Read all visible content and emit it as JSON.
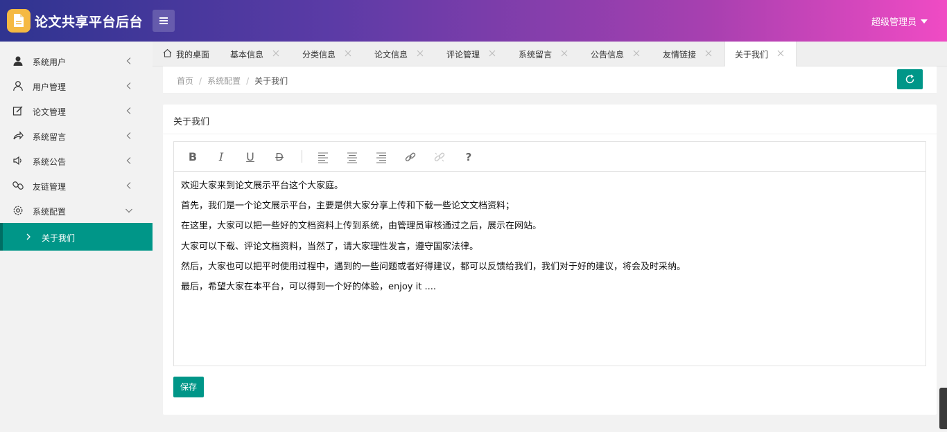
{
  "header": {
    "app_title": "论文共享平台后台",
    "user_name": "超级管理员",
    "brand_gradient": [
      "#2f3490",
      "#f04bc4"
    ],
    "logo_color": "#f5b942"
  },
  "sidebar": {
    "items": [
      {
        "label": "系统用户",
        "icon": "user-solid-icon"
      },
      {
        "label": "用户管理",
        "icon": "user-outline-icon"
      },
      {
        "label": "论文管理",
        "icon": "edit-icon"
      },
      {
        "label": "系统留言",
        "icon": "share-icon"
      },
      {
        "label": "系统公告",
        "icon": "speaker-icon"
      },
      {
        "label": "友链管理",
        "icon": "link-icon"
      },
      {
        "label": "系统配置",
        "icon": "gear-icon"
      }
    ],
    "sub_item": {
      "label": "关于我们"
    },
    "accent_color": "#009688"
  },
  "tabs": [
    {
      "label": "我的桌面"
    },
    {
      "label": "基本信息"
    },
    {
      "label": "分类信息"
    },
    {
      "label": "论文信息"
    },
    {
      "label": "评论管理"
    },
    {
      "label": "系统留言"
    },
    {
      "label": "公告信息"
    },
    {
      "label": "友情链接"
    },
    {
      "label": "关于我们"
    }
  ],
  "breadcrumb": {
    "home": "首页",
    "sep": "/",
    "parent": "系统配置",
    "current": "关于我们"
  },
  "card": {
    "title": "关于我们",
    "content_lines": [
      "欢迎大家来到论文展示平台这个大家庭。",
      "首先，我们是一个论文展示平台，主要是供大家分享上传和下载一些论文文档资料；",
      "在这里，大家可以把一些好的文档资料上传到系统，由管理员审核通过之后，展示在网站。",
      "大家可以下载、评论文档资料，当然了，请大家理性发言，遵守国家法律。",
      "然后，大家也可以把平时使用过程中，遇到的一些问题或者好得建议，都可以反馈给我们，我们对于好的建议，将会及时采纳。",
      "最后，希望大家在本平台，可以得到一个好的体验，enjoy it ...."
    ],
    "save_label": "保存"
  },
  "toolbar": {
    "bold": "B",
    "italic": "I",
    "underline": "U",
    "strike": "D",
    "help": "?"
  }
}
